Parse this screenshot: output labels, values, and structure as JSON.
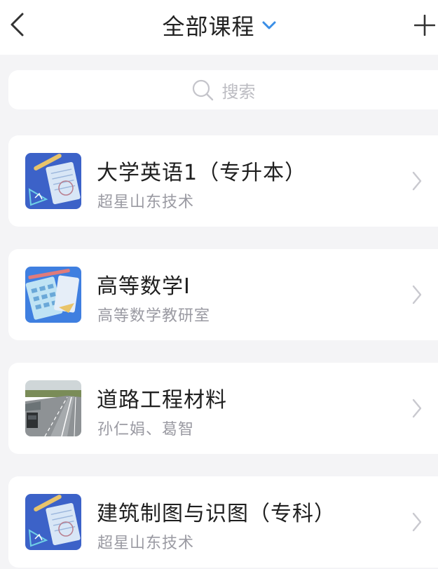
{
  "header": {
    "title": "全部课程",
    "back_icon": "chevron-left-icon",
    "dropdown_icon": "chevron-down-icon",
    "add_icon": "plus-icon",
    "accent_color": "#3a8ee6"
  },
  "search": {
    "placeholder": "搜索",
    "icon": "search-icon"
  },
  "courses": [
    {
      "title": "大学英语1（专升本）",
      "subtitle": "超星山东技术",
      "thumbnail": "notebook-cover-icon"
    },
    {
      "title": "高等数学I",
      "subtitle": "高等数学教研室",
      "thumbnail": "notebook-calculator-cover-icon"
    },
    {
      "title": "道路工程材料",
      "subtitle": "孙仁娟、葛智",
      "thumbnail": "highway-photo"
    },
    {
      "title": "建筑制图与识图（专科）",
      "subtitle": "超星山东技术",
      "thumbnail": "notebook-cover-icon"
    }
  ]
}
